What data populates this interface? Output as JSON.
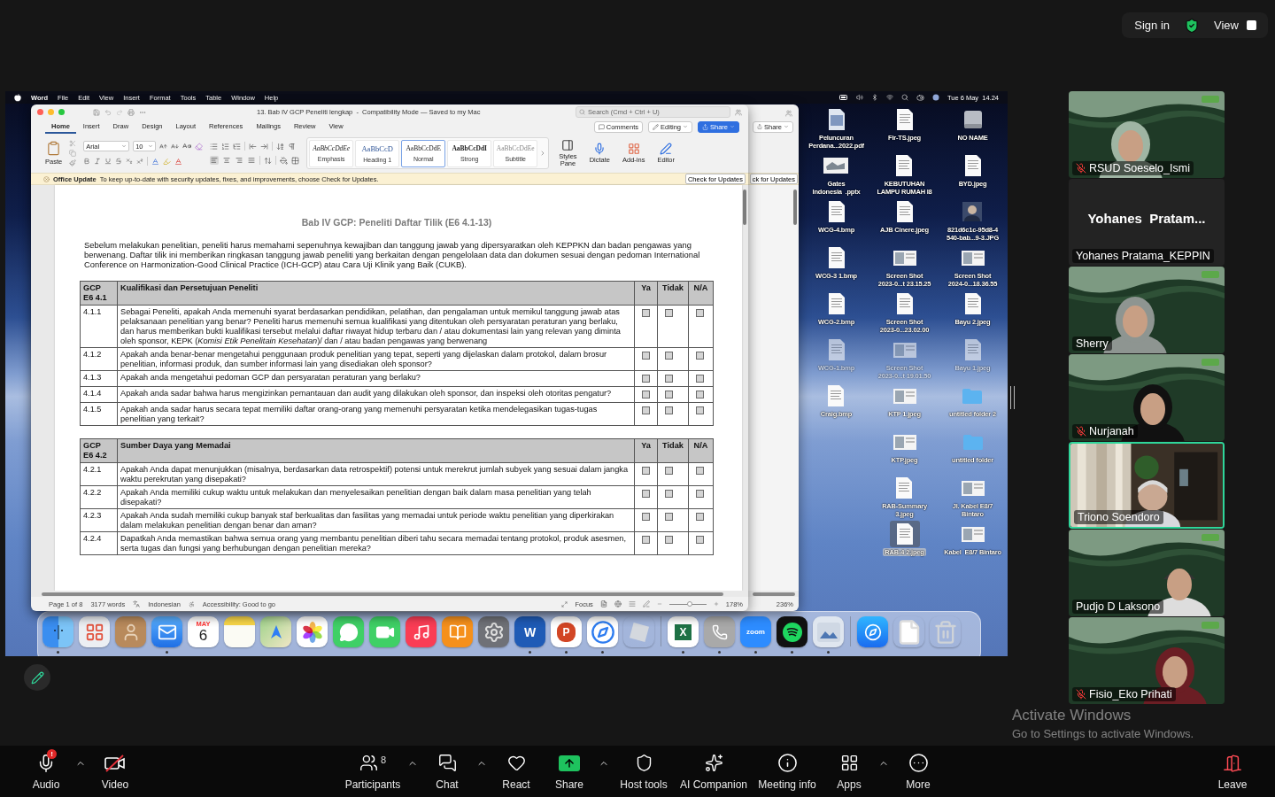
{
  "top_bar": {
    "sign_in": "Sign in",
    "view": "View"
  },
  "shared_screen": {
    "menu_bar": {
      "app": "Word",
      "menus": [
        "File",
        "Edit",
        "View",
        "Insert",
        "Format",
        "Tools",
        "Table",
        "Window",
        "Help"
      ],
      "clock": "Tue 6 May  14.24"
    },
    "back_window": {
      "share": "Share",
      "update_button": "ck for Updates",
      "zoom": "236%"
    },
    "word_window": {
      "title": "13. Bab IV GCP Peneliti lengkap  -  Compatibility Mode — Saved to my Mac",
      "search": {
        "placeholder": "Search (Cmd + Ctrl + U)"
      },
      "tabs": [
        {
          "label": "Home",
          "selected": true
        },
        {
          "label": "Insert",
          "selected": false
        },
        {
          "label": "Draw",
          "selected": false
        },
        {
          "label": "Design",
          "selected": false
        },
        {
          "label": "Layout",
          "selected": false
        },
        {
          "label": "References",
          "selected": false
        },
        {
          "label": "Mailings",
          "selected": false
        },
        {
          "label": "Review",
          "selected": false
        },
        {
          "label": "View",
          "selected": false
        }
      ],
      "comments": "Comments",
      "editing": "Editing",
      "share": "Share",
      "ribbon": {
        "paste": "Paste",
        "font": "Arial",
        "size": "10",
        "alignments": [
          {
            "kind": "left",
            "selected": true
          },
          {
            "kind": "center",
            "selected": false
          },
          {
            "kind": "right",
            "selected": false
          },
          {
            "kind": "justify",
            "selected": false
          }
        ],
        "styles": [
          {
            "kind": "emphasis",
            "preview": "AaBbCcDdEe",
            "label": "Emphasis",
            "selected": false
          },
          {
            "kind": "heading",
            "preview": "AaBbCcD",
            "label": "Heading 1",
            "selected": false
          },
          {
            "kind": "normal",
            "preview": "AaBbCcDdE",
            "label": "Normal",
            "selected": true
          },
          {
            "kind": "strong",
            "preview": "AaBbCcDdI",
            "label": "Strong",
            "selected": false
          },
          {
            "kind": "subtitle",
            "preview": "AaBbCcDdEe",
            "label": "Subtitle",
            "selected": false
          }
        ],
        "tools": [
          {
            "kind": "styles_pane",
            "label": "Styles\nPane"
          },
          {
            "kind": "dictate",
            "label": "Dictate"
          },
          {
            "kind": "addins",
            "label": "Add-ins"
          },
          {
            "kind": "editor",
            "label": "Editor"
          }
        ]
      },
      "update_bar": {
        "title": "Office Update",
        "message": "To keep up-to-date with security updates, fixes, and improvements, choose Check for Updates.",
        "button": "Check for Updates"
      },
      "document": {
        "heading": "Bab IV GCP: Peneliti Daftar Tilik (E6 4.1-13)",
        "intro": "Sebelum melakukan penelitian, peneliti harus memahami sepenuhnya kewajiban dan tanggung jawab yang dipersyaratkan oleh KEPPKN dan badan pengawas yang berwenang. Daftar tilik ini memberikan ringkasan tanggung jawab peneliti yang berkaitan dengan pengelolaan data dan dokumen sesuai dengan pedoman International Conference on Harmonization-Good Clinical Practice (ICH-GCP) atau Cara Uji Klinik yang Baik (CUKB).",
        "tables": [
          {
            "code": "GCP\nE6 4.1",
            "title": "Kualifikasi dan Persetujuan Peneliti",
            "columns": [
              "Ya",
              "Tidak",
              "N/A"
            ],
            "rows": [
              {
                "number": "4.1.1",
                "question": "Sebagai Peneliti, apakah Anda memenuhi syarat berdasarkan pendidikan, pelatihan, dan pengalaman untuk memikul tanggung jawab atas pelaksanaan penelitian yang benar? Peneliti harus memenuhi semua kualifikasi yang ditentukan oleh persyaratan peraturan yang berlaku, dan harus memberikan bukti kualifikasi tersebut melalui daftar riwayat hidup terbaru dan / atau dokumentasi lain yang relevan yang diminta oleh sponsor, KEPK (*Komisi Etik Penelitain Kesehatan*)/ dan / atau badan pengawas yang berwenang",
                "checks": [
                  false,
                  false,
                  false
                ]
              },
              {
                "number": "4.1.2",
                "question": "Apakah anda benar-benar mengetahui penggunaan produk penelitian yang tepat, seperti yang dijelaskan dalam protokol, dalam brosur penelitian, informasi produk, dan sumber informasi lain yang disediakan oleh sponsor?",
                "checks": [
                  false,
                  false,
                  false
                ]
              },
              {
                "number": "4.1.3",
                "question": "Apakah anda mengetahui pedoman GCP dan persyaratan peraturan yang berlaku?",
                "checks": [
                  false,
                  false,
                  false
                ]
              },
              {
                "number": "4.1.4",
                "question": "Apakah anda sadar bahwa harus mengizinkan pemantauan dan audit yang dilakukan oleh sponsor, dan inspeksi oleh otoritas pengatur?",
                "checks": [
                  false,
                  false,
                  false
                ]
              },
              {
                "number": "4.1.5",
                "question": "Apakah anda sadar harus secara tepat memiliki daftar orang-orang yang memenuhi persyaratan ketika mendelegasikan tugas-tugas penelitian yang terkait?",
                "checks": [
                  false,
                  false,
                  false
                ]
              }
            ]
          },
          {
            "code": "GCP\nE6 4.2",
            "title": "Sumber Daya yang Memadai",
            "columns": [
              "Ya",
              "Tidak",
              "N/A"
            ],
            "rows": [
              {
                "number": "4.2.1",
                "question": "Apakah Anda dapat menunjukkan (misalnya, berdasarkan data retrospektif) potensi untuk merekrut jumlah subyek yang sesuai dalam jangka waktu perekrutan yang disepakati?",
                "checks": [
                  false,
                  false,
                  false
                ]
              },
              {
                "number": "4.2.2",
                "question": "Apakah Anda memiliki cukup waktu untuk melakukan dan menyelesaikan penelitian dengan baik dalam masa penelitian yang telah disepakati?",
                "checks": [
                  false,
                  false,
                  false
                ]
              },
              {
                "number": "4.2.3",
                "question": "Apakah Anda sudah memiliki cukup banyak staf berkualitas dan fasilitas yang memadai untuk periode waktu penelitian yang diperkirakan dalam melakukan penelitian dengan benar dan aman?",
                "checks": [
                  false,
                  false,
                  false
                ]
              },
              {
                "number": "4.2.4",
                "question": "Dapatkah Anda memastikan bahwa semua orang yang membantu penelitian diberi tahu secara memadai tentang protokol, produk asesmen, serta tugas dan fungsi yang berhubungan dengan penelitian mereka?",
                "checks": [
                  false,
                  false,
                  false
                ]
              }
            ]
          }
        ]
      },
      "status_bar": {
        "page": "Page 1 of 8",
        "words": "3177 words",
        "language": "Indonesian",
        "accessibility": "Accessibility: Good to go",
        "focus": "Focus",
        "zoom": "178%",
        "zoom_slider": {
          "level": 0.55
        }
      }
    },
    "desktop_columns": [
      [
        {
          "label": "Peluncuran\nPerdana...2022.pdf",
          "kind": "pdf",
          "faded": false,
          "selected": false
        },
        {
          "label": "Gates\nIndonesia  .pptx",
          "kind": "slides",
          "faded": false,
          "selected": false
        },
        {
          "label": "WCG-4.bmp",
          "kind": "document",
          "faded": false,
          "selected": false
        },
        {
          "label": "WCG-3 1.bmp",
          "kind": "document",
          "faded": false,
          "selected": false
        },
        {
          "label": "WCG-2.bmp",
          "kind": "document",
          "faded": false,
          "selected": false
        },
        {
          "label": "WCG-1.bmp",
          "kind": "document",
          "faded": true,
          "selected": false
        },
        {
          "label": "Craig.bmp",
          "kind": "document",
          "faded": false,
          "selected": false
        }
      ],
      [
        {
          "label": "Fir-TS.jpeg",
          "kind": "document",
          "faded": false,
          "selected": false
        },
        {
          "label": "KEBUTUHAN\nLAMPU RUMAH I8",
          "kind": "document",
          "faded": false,
          "selected": false
        },
        {
          "label": "AJB Cinere.jpeg",
          "kind": "document",
          "faded": false,
          "selected": false
        },
        {
          "label": "Screen Shot\n2023-0...t 23.15.25",
          "kind": "screenshot",
          "faded": false,
          "selected": false
        },
        {
          "label": "Screen Shot\n2023-0...23.02.00",
          "kind": "document",
          "faded": false,
          "selected": false
        },
        {
          "label": "Screen Shot\n2023-0...t 19.01.50",
          "kind": "screenshot",
          "faded": true,
          "selected": false
        },
        {
          "label": "KTP 1.jpeg",
          "kind": "screenshot",
          "faded": false,
          "selected": false
        },
        {
          "label": "KTP.jpeg",
          "kind": "screenshot",
          "faded": false,
          "selected": false
        },
        {
          "label": "RAB-Summary\n3.jpeg",
          "kind": "document",
          "faded": false,
          "selected": false
        },
        {
          "label": "RAB-4 2.jpeg",
          "kind": "document",
          "faded": false,
          "selected": true
        }
      ],
      [
        {
          "label": "NO NAME",
          "kind": "drive",
          "faded": false,
          "selected": false
        },
        {
          "label": "BYD.jpeg",
          "kind": "document",
          "faded": false,
          "selected": false
        },
        {
          "label": "821d6c1c-95d8-4\n540-bab...9-3.JPG",
          "faded": false,
          "selected": false
        },
        {
          "label": "Screen Shot\n2024-0...18.36.55",
          "kind": "screenshot",
          "faded": false,
          "selected": false
        },
        {
          "label": "Bayu 2.jpeg",
          "kind": "document",
          "faded": false,
          "selected": false
        },
        {
          "label": "Bayu 1.jpeg",
          "kind": "document",
          "faded": true,
          "selected": false
        },
        {
          "label": "untitled folder 2",
          "kind": "folder",
          "faded": false,
          "selected": false
        },
        {
          "label": "untitled folder",
          "kind": "folder",
          "faded": false,
          "selected": false
        },
        {
          "label": "Jl. Kabel E8/7\nBintaro",
          "kind": "screenshot",
          "faded": false,
          "selected": false
        },
        {
          "label": "Kabel  E8/7 Bintaro",
          "kind": "screenshot",
          "faded": false,
          "selected": false
        }
      ]
    ],
    "dock": [
      {
        "kind": "finder",
        "running": true
      },
      {
        "kind": "launchpad",
        "running": false
      },
      {
        "kind": "contacts",
        "running": false
      },
      {
        "kind": "mail",
        "running": true
      },
      {
        "kind": "calendar",
        "month": "MAY",
        "day": "6",
        "running": false
      },
      {
        "kind": "notes",
        "running": false
      },
      {
        "kind": "maps",
        "running": false
      },
      {
        "kind": "photos",
        "running": false
      },
      {
        "kind": "messages",
        "running": false
      },
      {
        "kind": "facetime",
        "running": false
      },
      {
        "kind": "music",
        "running": false
      },
      {
        "kind": "books",
        "running": false
      },
      {
        "kind": "settings",
        "running": false
      },
      {
        "kind": "word",
        "glyph": "W",
        "running": true
      },
      {
        "kind": "powerpoint",
        "glyph": "P",
        "running": true
      },
      {
        "kind": "safari",
        "running": true
      },
      {
        "kind": "game",
        "running": false
      },
      {
        "kind": "separator"
      },
      {
        "kind": "excel",
        "glyph": "X",
        "running": true
      },
      {
        "kind": "whatsapp",
        "running": true
      },
      {
        "kind": "zoom",
        "glyph": "zoom",
        "running": true
      },
      {
        "kind": "spotify",
        "running": true
      },
      {
        "kind": "preview",
        "running": true
      },
      {
        "kind": "separator"
      },
      {
        "kind": "appstore",
        "running": false
      },
      {
        "kind": "file",
        "running": false
      },
      {
        "kind": "trash",
        "running": false
      }
    ]
  },
  "participants": [
    {
      "name": "RSUD Soeselo_Ismi",
      "kind": "video",
      "muted": true,
      "speaking": false
    },
    {
      "name": "Yohanes Pratama_KEPPIN",
      "display_name": "Yohanes  Pratam...",
      "kind": "name_only",
      "muted": false,
      "speaking": false
    },
    {
      "name": "Sherry",
      "kind": "video",
      "muted": false,
      "speaking": false
    },
    {
      "name": "Nurjanah",
      "kind": "video",
      "muted": true,
      "speaking": false
    },
    {
      "name": "Triono Soendoro",
      "kind": "room",
      "muted": false,
      "speaking": true
    },
    {
      "name": "Pudjo D Laksono",
      "kind": "video",
      "muted": false,
      "speaking": false
    },
    {
      "name": "Fisio_Eko Prihati",
      "kind": "video",
      "muted": true,
      "speaking": false
    }
  ],
  "windows_notice": {
    "title": "Activate Windows",
    "message": "Go to Settings to activate Windows."
  },
  "toolbar": {
    "left": [
      {
        "label": "Audio",
        "kind": "audio",
        "badge": "!",
        "caret": true
      },
      {
        "label": "Video",
        "kind": "video_off",
        "caret": false
      }
    ],
    "center": [
      {
        "label": "Participants",
        "kind": "participants",
        "count": "8",
        "caret": true
      },
      {
        "label": "Chat",
        "kind": "chat",
        "caret": true
      },
      {
        "label": "React",
        "kind": "react",
        "caret": false
      },
      {
        "label": "Share",
        "kind": "share",
        "caret": true
      },
      {
        "label": "Host tools",
        "kind": "host_tools",
        "caret": false
      },
      {
        "label": "AI Companion",
        "kind": "ai",
        "caret": false
      },
      {
        "label": "Meeting info",
        "kind": "info",
        "caret": false
      },
      {
        "label": "Apps",
        "kind": "apps",
        "caret": true
      },
      {
        "label": "More",
        "kind": "more",
        "caret": false
      }
    ],
    "right": [
      {
        "label": "Leave",
        "kind": "leave",
        "caret": false
      }
    ]
  }
}
